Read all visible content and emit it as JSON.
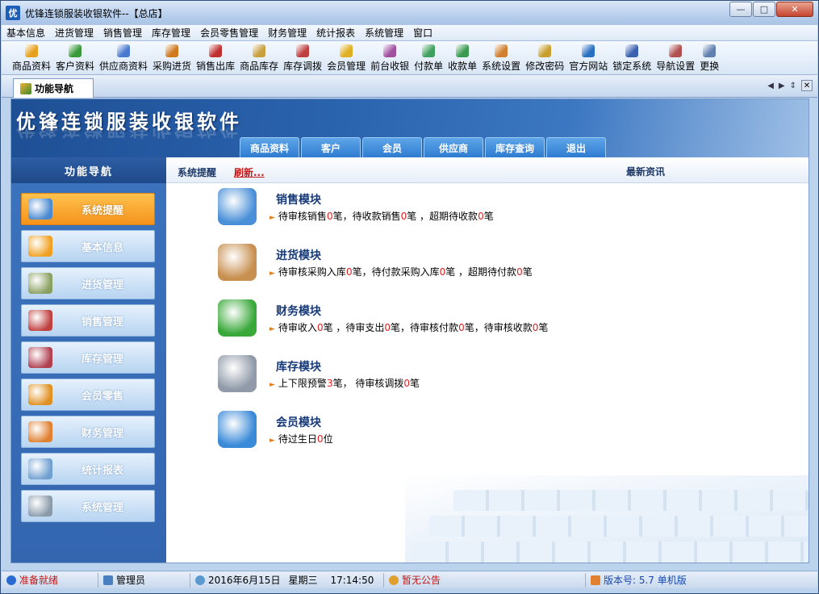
{
  "window": {
    "title": "优锋连锁服装收银软件--【总店】",
    "app_icon_glyph": "优",
    "minimize": "—",
    "maximize": "□",
    "close": "✕"
  },
  "menu": [
    "基本信息",
    "进货管理",
    "销售管理",
    "库存管理",
    "会员零售管理",
    "财务管理",
    "统计报表",
    "系统管理",
    "窗口"
  ],
  "toolbar": [
    {
      "label": "商品资料",
      "color": "#e8a020"
    },
    {
      "label": "客户资料",
      "color": "#3a9a3a"
    },
    {
      "label": "供应商资料",
      "color": "#4a7ad0"
    },
    {
      "label": "采购进货",
      "color": "#d07a20"
    },
    {
      "label": "销售出库",
      "color": "#c03030"
    },
    {
      "label": "商品库存",
      "color": "#c8a040"
    },
    {
      "label": "库存调拨",
      "color": "#c04040"
    },
    {
      "label": "会员管理",
      "color": "#e0b020"
    },
    {
      "label": "前台收银",
      "color": "#a050a0"
    },
    {
      "label": "付款单",
      "color": "#40a060"
    },
    {
      "label": "收款单",
      "color": "#3a9a50"
    },
    {
      "label": "系统设置",
      "color": "#d08030"
    },
    {
      "label": "修改密码",
      "color": "#c8a030"
    },
    {
      "label": "官方网站",
      "color": "#2a70c0"
    },
    {
      "label": "锁定系统",
      "color": "#3a60b0"
    },
    {
      "label": "导航设置",
      "color": "#b05050"
    },
    {
      "label": "更换",
      "color": "#6080b0"
    }
  ],
  "tab": {
    "label": "功能导航",
    "ctrl_prev": "◀",
    "ctrl_next": "▶",
    "ctrl_list": "⇕",
    "ctrl_close": "✕"
  },
  "banner": {
    "title": "优锋连锁服装收银软件",
    "tabs": [
      "商品资料",
      "客户",
      "会员",
      "供应商",
      "库存查询",
      "退出"
    ]
  },
  "sidebar": {
    "header": "功能导航",
    "items": [
      {
        "label": "系统提醒",
        "icon": "system-remind-icon",
        "color": "#4a8ad0"
      },
      {
        "label": "基本信息",
        "icon": "basic-info-icon",
        "color": "#f0a020"
      },
      {
        "label": "进货管理",
        "icon": "cart-icon",
        "color": "#8aa060"
      },
      {
        "label": "销售管理",
        "icon": "sales-cart-icon",
        "color": "#c04040"
      },
      {
        "label": "库存管理",
        "icon": "warehouse-icon",
        "color": "#b04050"
      },
      {
        "label": "会员零售",
        "icon": "member-icon",
        "color": "#e09020"
      },
      {
        "label": "财务管理",
        "icon": "finance-icon",
        "color": "#e08030"
      },
      {
        "label": "统计报表",
        "icon": "report-icon",
        "color": "#70a0d0"
      },
      {
        "label": "系统管理",
        "icon": "gear-icon",
        "color": "#8a9aaa"
      }
    ]
  },
  "main": {
    "left_header": "系统提醒",
    "refresh": "刷新...",
    "right_header": "最新资讯",
    "modules": [
      {
        "title": "销售模块",
        "color": "#4a90d8",
        "parts": [
          "待审核销售",
          "0",
          "笔，待收款销售",
          "0",
          "笔 ，超期待收款",
          "0",
          "笔"
        ]
      },
      {
        "title": "进货模块",
        "color": "#c89050",
        "parts": [
          "待审核采购入库",
          "0",
          "笔，待付款采购入库",
          "0",
          "笔 ，超期待付款",
          "0",
          "笔"
        ]
      },
      {
        "title": "财务模块",
        "color": "#38a838",
        "parts": [
          "待审收入",
          "0",
          "笔 ，待审支出",
          "0",
          "笔，待审核付款",
          "0",
          "笔，待审核收款",
          "0",
          "笔"
        ]
      },
      {
        "title": "库存模块",
        "color": "#909aa8",
        "parts": [
          "上下限预警",
          "3",
          "笔，   待审核调拨",
          "0",
          "笔"
        ]
      },
      {
        "title": "会员模块",
        "color": "#3a8ad8",
        "parts": [
          "待过生日",
          "0",
          "位"
        ]
      }
    ]
  },
  "status": {
    "ready": "准备就绪",
    "user": "管理员",
    "date": "2016年6月15日",
    "weekday": "星期三",
    "time": "17:14:50",
    "notice": "暂无公告",
    "version": "版本号: 5.7 单机版"
  }
}
